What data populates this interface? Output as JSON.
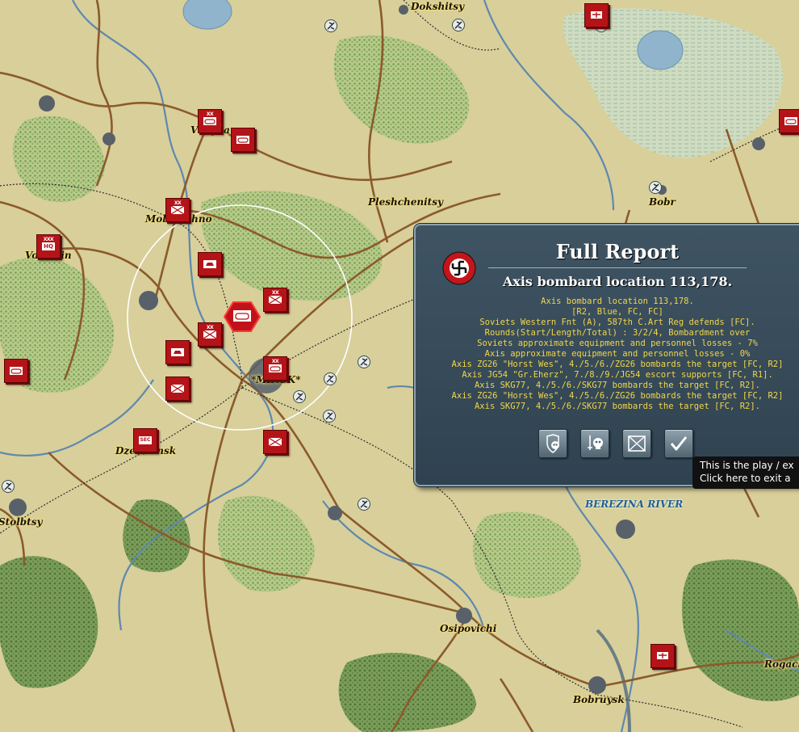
{
  "map": {
    "towns": [
      {
        "name": "Dokshitsy"
      },
      {
        "name": "Vileyka"
      },
      {
        "name": "Molodechno"
      },
      {
        "name": "Volozhin"
      },
      {
        "name": "Pleshchenitsy"
      },
      {
        "name": "Bobr"
      },
      {
        "name": "*MINSK*"
      },
      {
        "name": "Dzerzhinsk"
      },
      {
        "name": "Stolbtsy"
      },
      {
        "name": "Osipovichi"
      },
      {
        "name": "Bobruysk"
      },
      {
        "name": "Rogachev"
      }
    ],
    "river_label": "BEREZINA RIVER",
    "counter_tags": {
      "hq": "HQ",
      "sec": "SEC",
      "xx": "XX",
      "xxx": "XXX"
    }
  },
  "report": {
    "title": "Full Report",
    "subtitle": "Axis bombard location 113,178.",
    "lines": [
      "Axis bombard location 113,178.",
      "[R2, Blue, FC, FC]",
      "Soviets Western Fnt (A), 587th C.Art Reg defends [FC].",
      "Rounds(Start/Length/Total) : 3/2/4, Bombardment over",
      "Soviets approximate equipment and personnel losses - 7%",
      "Axis approximate equipment and personnel losses - 0%",
      "Axis ZG26 \"Horst Wes\", 4./5./6./ZG26 bombards the target [FC, R2]",
      "Axis JG54 \"Gr.Eherz\", 7./8./9./JG54 escort supports [FC, R1].",
      "Axis SKG77, 4./5./6./SKG77 bombards the target [FC, R2].",
      "Axis ZG26 \"Horst Wes\", 4./5./6./ZG26 bombards the target [FC, R2]",
      "Axis SKG77, 4./5./6./SKG77 bombards the target [FC, R2]."
    ],
    "buttons": [
      {
        "icon": "shield-skull-icon"
      },
      {
        "icon": "skull-sword-icon"
      },
      {
        "icon": "crossed-infantry-icon"
      },
      {
        "icon": "checkmark-icon"
      }
    ]
  },
  "tooltip": {
    "line1": "This is the play / ex",
    "line2": "Click here to exit a"
  },
  "colors": {
    "soviet_red": "#b41418",
    "report_bg": "#3f5463",
    "report_text": "#f2d64a"
  }
}
